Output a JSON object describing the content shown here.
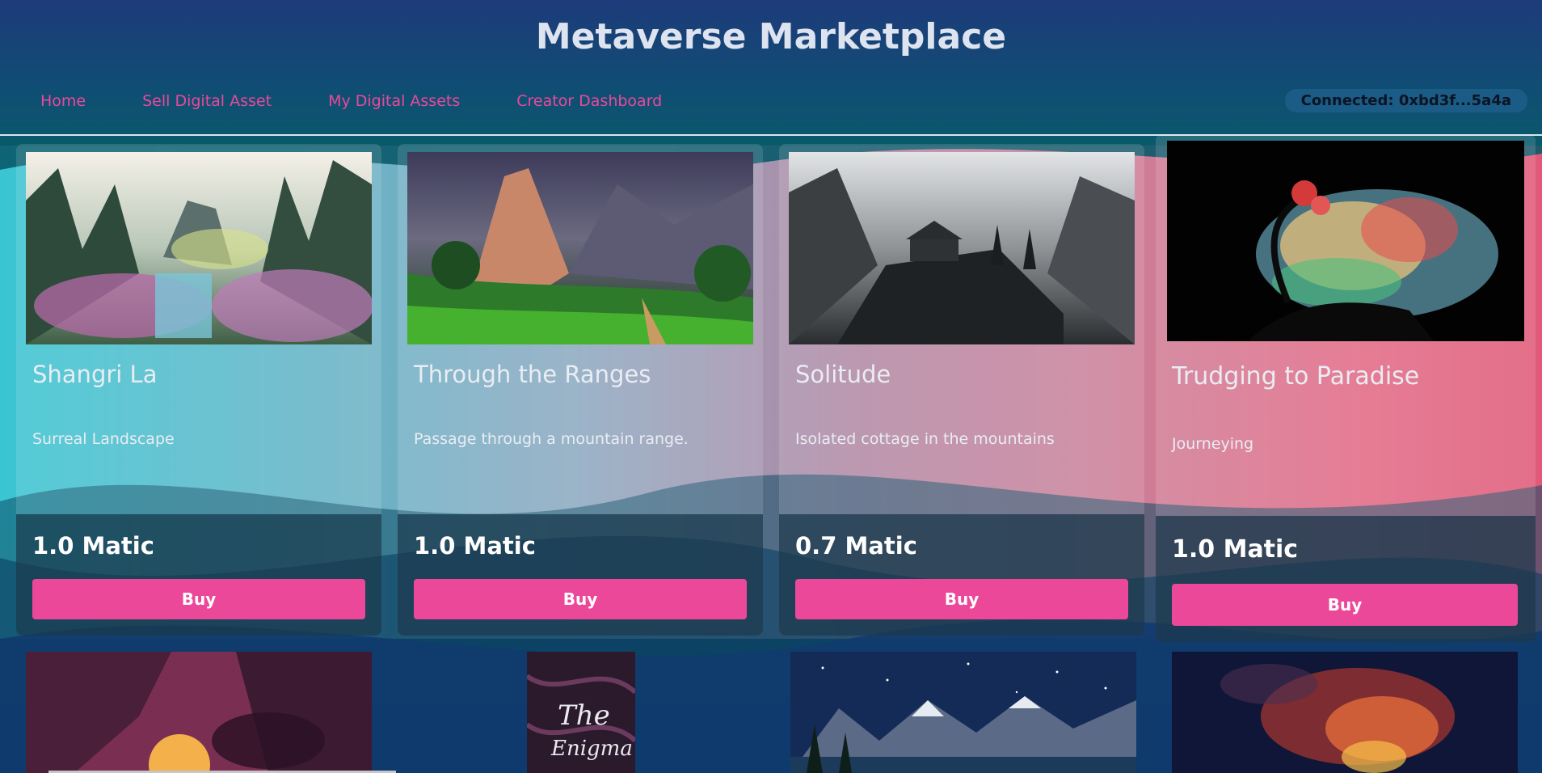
{
  "header": {
    "title": "Metaverse Marketplace",
    "nav": [
      "Home",
      "Sell Digital Asset",
      "My Digital Assets",
      "Creator Dashboard"
    ],
    "wallet": "Connected: 0xbd3f...5a4a"
  },
  "listings": [
    {
      "name": "Shangri La",
      "description": "Surreal Landscape",
      "price": "1.0 Matic",
      "buy_label": "Buy"
    },
    {
      "name": "Through the Ranges",
      "description": "Passage through a mountain range.",
      "price": "1.0 Matic",
      "buy_label": "Buy"
    },
    {
      "name": "Solitude",
      "description": "Isolated cottage in the mountains",
      "price": "0.7 Matic",
      "buy_label": "Buy"
    },
    {
      "name": "Trudging to Paradise",
      "description": "Journeying",
      "price": "1.0 Matic",
      "buy_label": "Buy"
    }
  ],
  "row2_thumbnails": [
    "sunset-canyon-image",
    "the-enigma-image",
    "starry-mountains-image",
    "nebula-image"
  ]
}
